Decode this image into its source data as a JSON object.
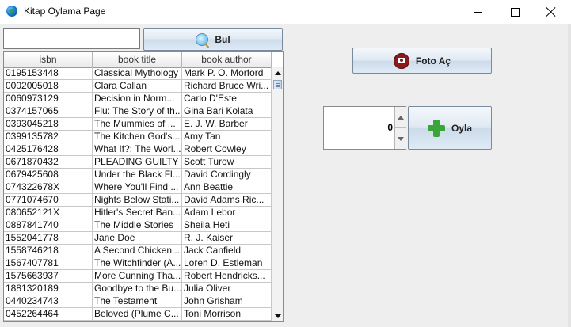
{
  "window": {
    "title": "Kitap Oylama Page"
  },
  "search": {
    "value": "",
    "button_label": "Bul",
    "icon": "search-icon"
  },
  "table": {
    "columns": [
      "isbn",
      "book title",
      "book author"
    ],
    "rows": [
      [
        "0195153448",
        "Classical Mythology",
        "Mark P. O. Morford"
      ],
      [
        "0002005018",
        "Clara Callan",
        "Richard Bruce Wri..."
      ],
      [
        "0060973129",
        "Decision in Norm...",
        "Carlo D'Este"
      ],
      [
        "0374157065",
        "Flu: The Story of th...",
        "Gina Bari Kolata"
      ],
      [
        "0393045218",
        "The Mummies of ...",
        "E. J. W. Barber"
      ],
      [
        "0399135782",
        "The Kitchen God's...",
        "Amy Tan"
      ],
      [
        "0425176428",
        "What If?: The Worl...",
        "Robert Cowley"
      ],
      [
        "0671870432",
        "PLEADING GUILTY",
        "Scott Turow"
      ],
      [
        "0679425608",
        "Under the Black Fl...",
        "David Cordingly"
      ],
      [
        "074322678X",
        "Where You'll Find ...",
        "Ann Beattie"
      ],
      [
        "0771074670",
        "Nights Below Stati...",
        "David Adams Ric..."
      ],
      [
        "080652121X",
        "Hitler's Secret Ban...",
        "Adam Lebor"
      ],
      [
        "0887841740",
        "The Middle Stories",
        "Sheila Heti"
      ],
      [
        "1552041778",
        "Jane Doe",
        "R. J. Kaiser"
      ],
      [
        "1558746218",
        "A Second Chicken...",
        "Jack Canfield"
      ],
      [
        "1567407781",
        "The Witchfinder (A...",
        "Loren D. Estleman"
      ],
      [
        "1575663937",
        "More Cunning Tha...",
        "Robert Hendricks..."
      ],
      [
        "1881320189",
        "Goodbye to the Bu...",
        "Julia Oliver"
      ],
      [
        "0440234743",
        "The Testament",
        "John Grisham"
      ],
      [
        "0452264464",
        "Beloved (Plume C...",
        "Toni Morrison"
      ]
    ]
  },
  "photo_button": {
    "label": "Foto Aç",
    "icon": "camera-icon"
  },
  "vote": {
    "spinner_value": "0",
    "button_label": "Oyla",
    "icon": "plus-icon"
  }
}
